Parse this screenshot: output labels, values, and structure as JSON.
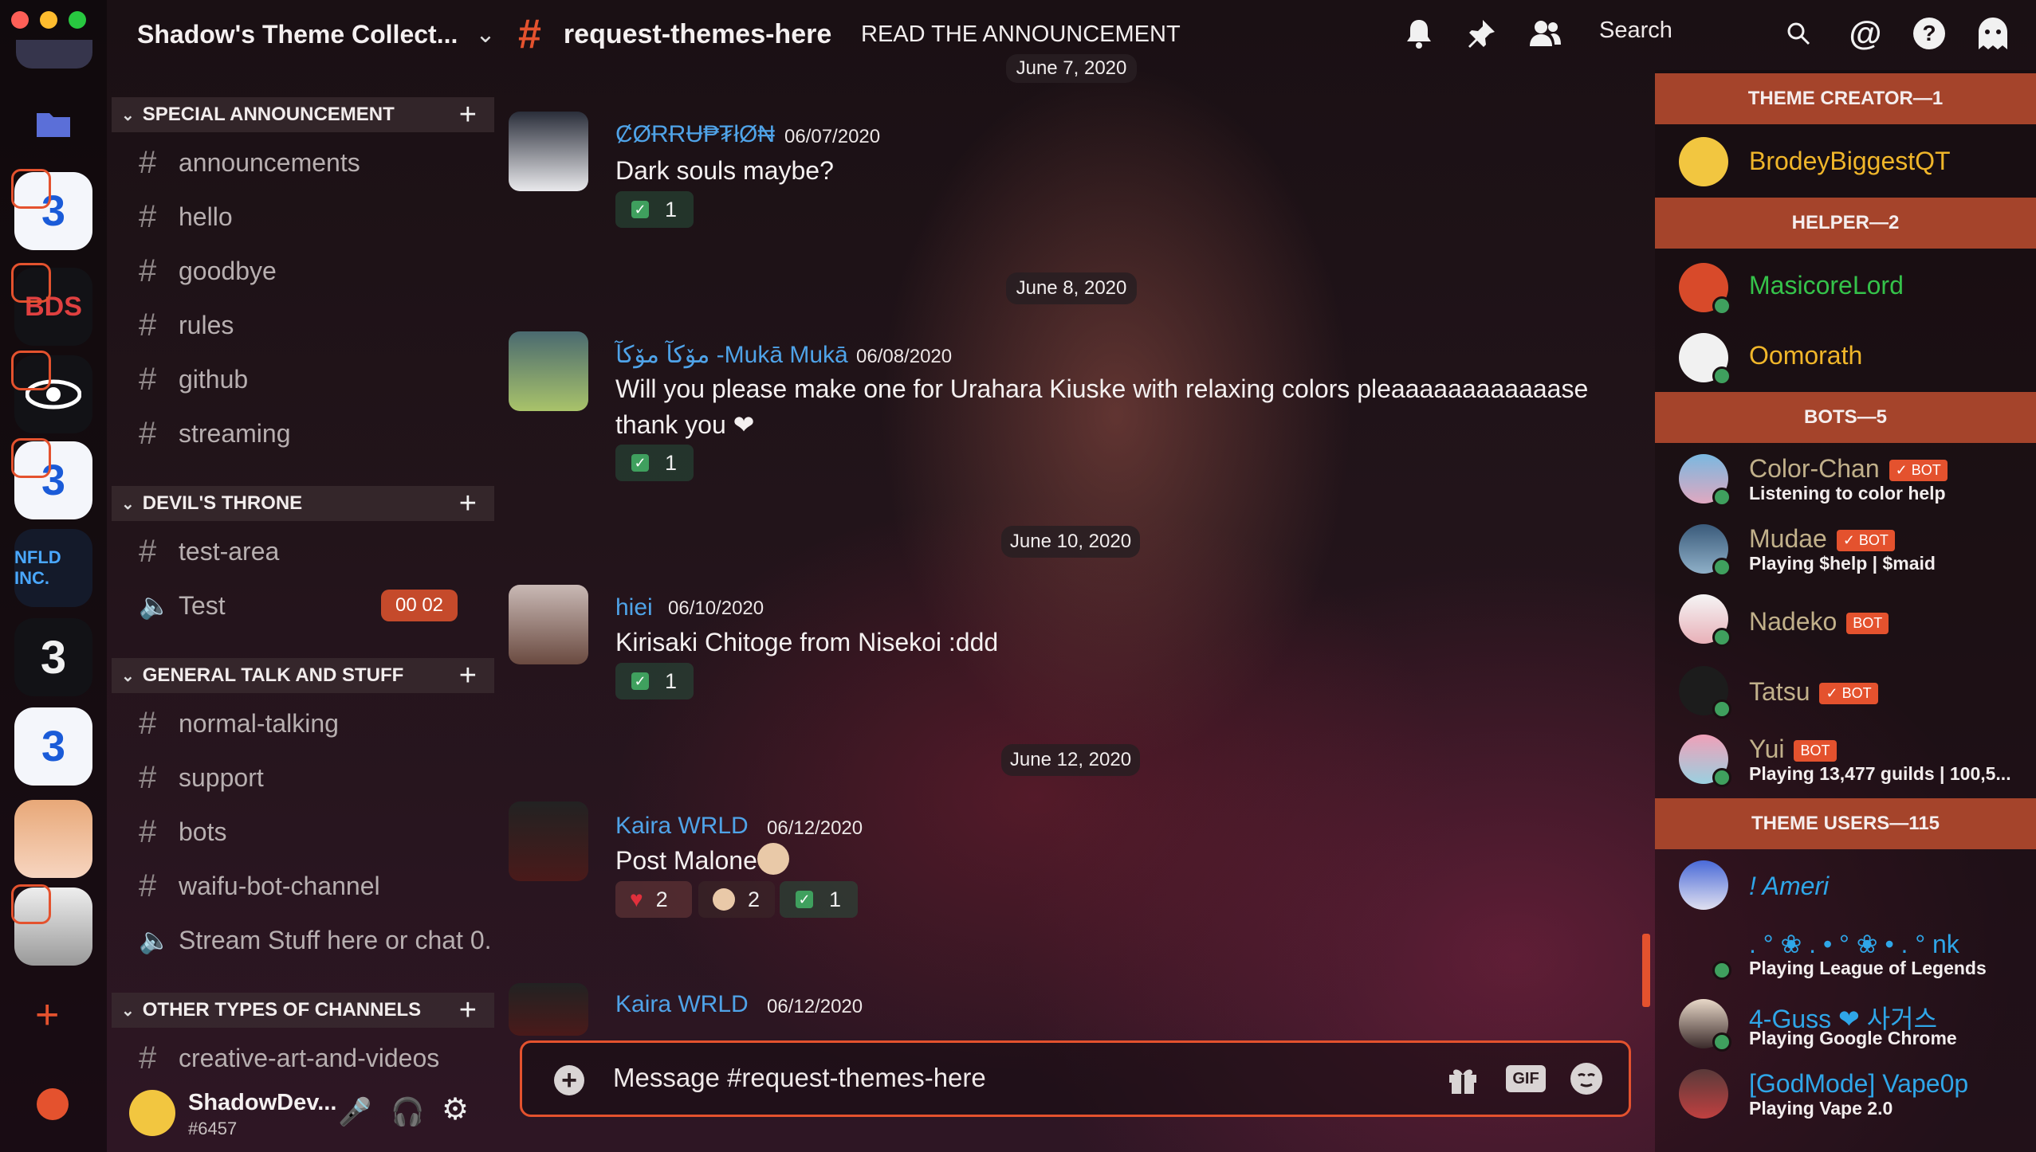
{
  "guild": {
    "name": "Shadow's Theme Collect..."
  },
  "topbar": {
    "channel": "request-themes-here",
    "topic": "READ THE ANNOUNCEMENT",
    "search_placeholder": "Search"
  },
  "categories": [
    {
      "name": "SPECIAL ANNOUNCEMENT"
    },
    {
      "name": "DEVIL'S THRONE"
    },
    {
      "name": "GENERAL TALK AND STUFF"
    },
    {
      "name": "OTHER TYPES OF CHANNELS"
    }
  ],
  "channels": {
    "special": [
      "announcements",
      "hello",
      "goodbye",
      "rules",
      "github",
      "streaming"
    ],
    "devils": [
      "test-area",
      "Test"
    ],
    "voice_timer": "00 02",
    "general": [
      "normal-talking",
      "support",
      "bots",
      "waifu-bot-channel",
      "Stream Stuff here or chat 0."
    ],
    "other": [
      "creative-art-and-videos"
    ]
  },
  "user_panel": {
    "name": "ShadowDev...",
    "tag": "#6457"
  },
  "messages": [
    {
      "date_divider": "June 7, 2020",
      "author": "ȻØɌɌɄ₱₮łØ₦",
      "timestamp": "06/07/2020",
      "text": "Dark souls maybe?",
      "reactions": [
        "1"
      ],
      "author_color": "#4fa3e8"
    },
    {
      "date_divider": "June 8, 2020",
      "author": "مۆكآ مۆكآ -Mukā Mukā",
      "timestamp": "06/08/2020",
      "text": "Will you please make one for Urahara Kiuske with relaxing colors pleaaaaaaaaaaaase",
      "text2": "thank you ❤",
      "reactions": [
        "1"
      ],
      "author_color": "#4fa3e8"
    },
    {
      "date_divider": "June 10, 2020",
      "author": "hiei",
      "timestamp": "06/10/2020",
      "text": "Kirisaki Chitoge from Nisekoi :ddd",
      "reactions": [
        "1"
      ],
      "author_color": "#4fa3e8"
    },
    {
      "date_divider": "June 12, 2020",
      "author": "Kaira WRLD",
      "timestamp": "06/12/2020",
      "text": "Post Malone",
      "reactions": [
        "2",
        "2",
        "1"
      ],
      "author_color": "#4fa3e8"
    },
    {
      "author": "Kaira WRLD",
      "timestamp": "06/12/2020",
      "author_color": "#4fa3e8"
    }
  ],
  "composer": {
    "placeholder": "Message #request-themes-here",
    "gif_label": "GIF"
  },
  "member_roles": [
    {
      "name": "THEME CREATOR—1",
      "members": [
        {
          "name": "BrodeyBiggestQT",
          "color": "#f0b62a"
        }
      ]
    },
    {
      "name": "HELPER—2",
      "members": [
        {
          "name": "MasicoreLord",
          "color": "#35c24a"
        },
        {
          "name": "Oomorath",
          "color": "#f0b62a"
        }
      ]
    },
    {
      "name": "BOTS—5",
      "members": [
        {
          "name": "Color-Chan",
          "bot": "✓ BOT",
          "status": "Listening to color help",
          "color": "#c1b08a"
        },
        {
          "name": "Mudae",
          "bot": "✓ BOT",
          "status": "Playing $help | $maid",
          "color": "#c1b08a"
        },
        {
          "name": "Nadeko",
          "bot": "BOT",
          "color": "#c1b08a"
        },
        {
          "name": "Tatsu",
          "bot": "✓ BOT",
          "color": "#c1b08a"
        },
        {
          "name": "Yui",
          "bot": "BOT",
          "status": "Playing 13,477 guilds | 100,5...",
          "color": "#c1b08a"
        }
      ]
    },
    {
      "name": "THEME USERS—115",
      "members": [
        {
          "name": "! Ameri",
          "color": "#2fa6e8"
        },
        {
          "name": ". ° ❀ . • ° ❀ • . ° nk",
          "status": "Playing League of Legends",
          "color": "#2fa6e8"
        },
        {
          "name": "4-Guss ❤ 사거스",
          "status": "Playing Google Chrome",
          "color": "#2fa6e8"
        },
        {
          "name": "[GodMode] Vape0p",
          "status": "Playing Vape 2.0",
          "color": "#2fa6e8"
        }
      ]
    }
  ],
  "colors": {
    "accent": "#e4522e",
    "role_band": "#a5442b",
    "online": "#3fa05e"
  }
}
